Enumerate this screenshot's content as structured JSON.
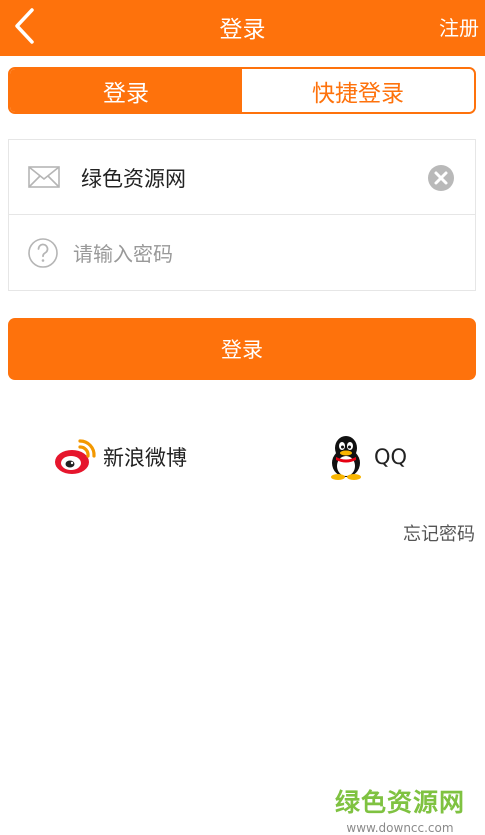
{
  "header": {
    "title": "登录",
    "register_label": "注册"
  },
  "tabs": [
    {
      "label": "登录",
      "active": true
    },
    {
      "label": "快捷登录",
      "active": false
    }
  ],
  "form": {
    "account_value": "绿色资源网",
    "password_placeholder": "请输入密码"
  },
  "login_button": {
    "label": "登录"
  },
  "social": [
    {
      "label": "新浪微博",
      "icon": "weibo-icon"
    },
    {
      "label": "QQ",
      "icon": "qq-icon"
    }
  ],
  "forgot_password": "忘记密码",
  "watermark": {
    "text": "绿色资源网",
    "url": "www.downcc.com"
  },
  "colors": {
    "accent": "#fe720c",
    "border": "#e6e6e6",
    "watermark_green": "#7fc241"
  }
}
